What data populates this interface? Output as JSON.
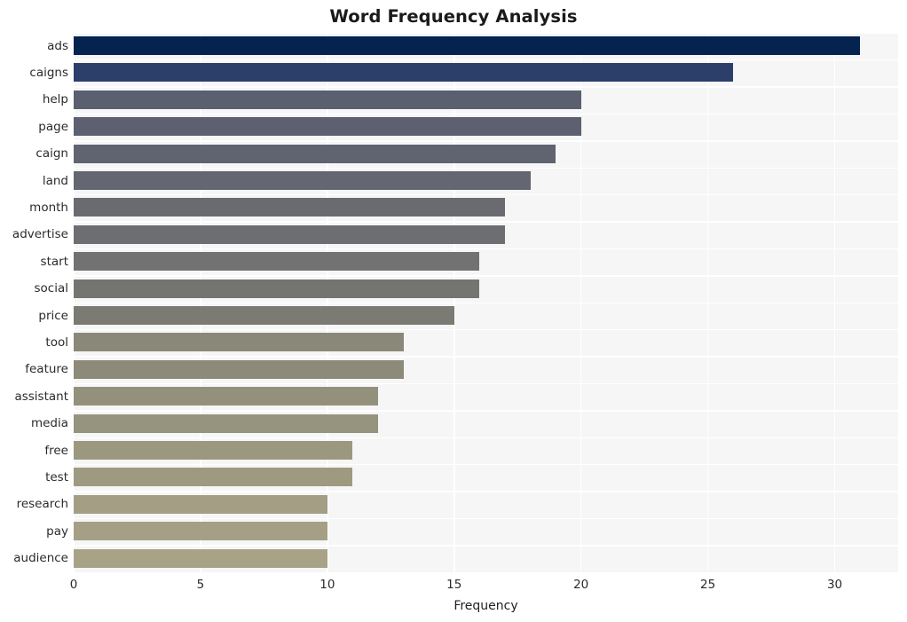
{
  "chart_data": {
    "type": "bar",
    "orientation": "horizontal",
    "title": "Word Frequency Analysis",
    "xlabel": "Frequency",
    "ylabel": "",
    "categories": [
      "ads",
      "caigns",
      "help",
      "page",
      "caign",
      "land",
      "month",
      "advertise",
      "start",
      "social",
      "price",
      "tool",
      "feature",
      "assistant",
      "media",
      "free",
      "test",
      "research",
      "pay",
      "audience"
    ],
    "values": [
      31,
      26,
      20,
      20,
      19,
      18,
      17,
      17,
      16,
      16,
      15,
      13,
      13,
      12,
      12,
      11,
      11,
      10,
      10,
      10
    ],
    "xticks": [
      0,
      5,
      10,
      15,
      20,
      25,
      30
    ],
    "xlim": [
      0,
      32.5
    ],
    "grid": true,
    "legend": "none",
    "bar_colors": [
      "#04234f",
      "#2c3f6b",
      "#5b6070",
      "#5c6070",
      "#606471",
      "#646771",
      "#696b71",
      "#6c6e71",
      "#717271",
      "#747571",
      "#7b7a73",
      "#8a8878",
      "#8d8a79",
      "#93907c",
      "#96937e",
      "#9c9880",
      "#9e9a81",
      "#a39e84",
      "#a5a085",
      "#a8a387"
    ],
    "plot_background": "#f6f6f6",
    "gridline_color": "#ffffff",
    "text_color": "#2b2b2b"
  }
}
